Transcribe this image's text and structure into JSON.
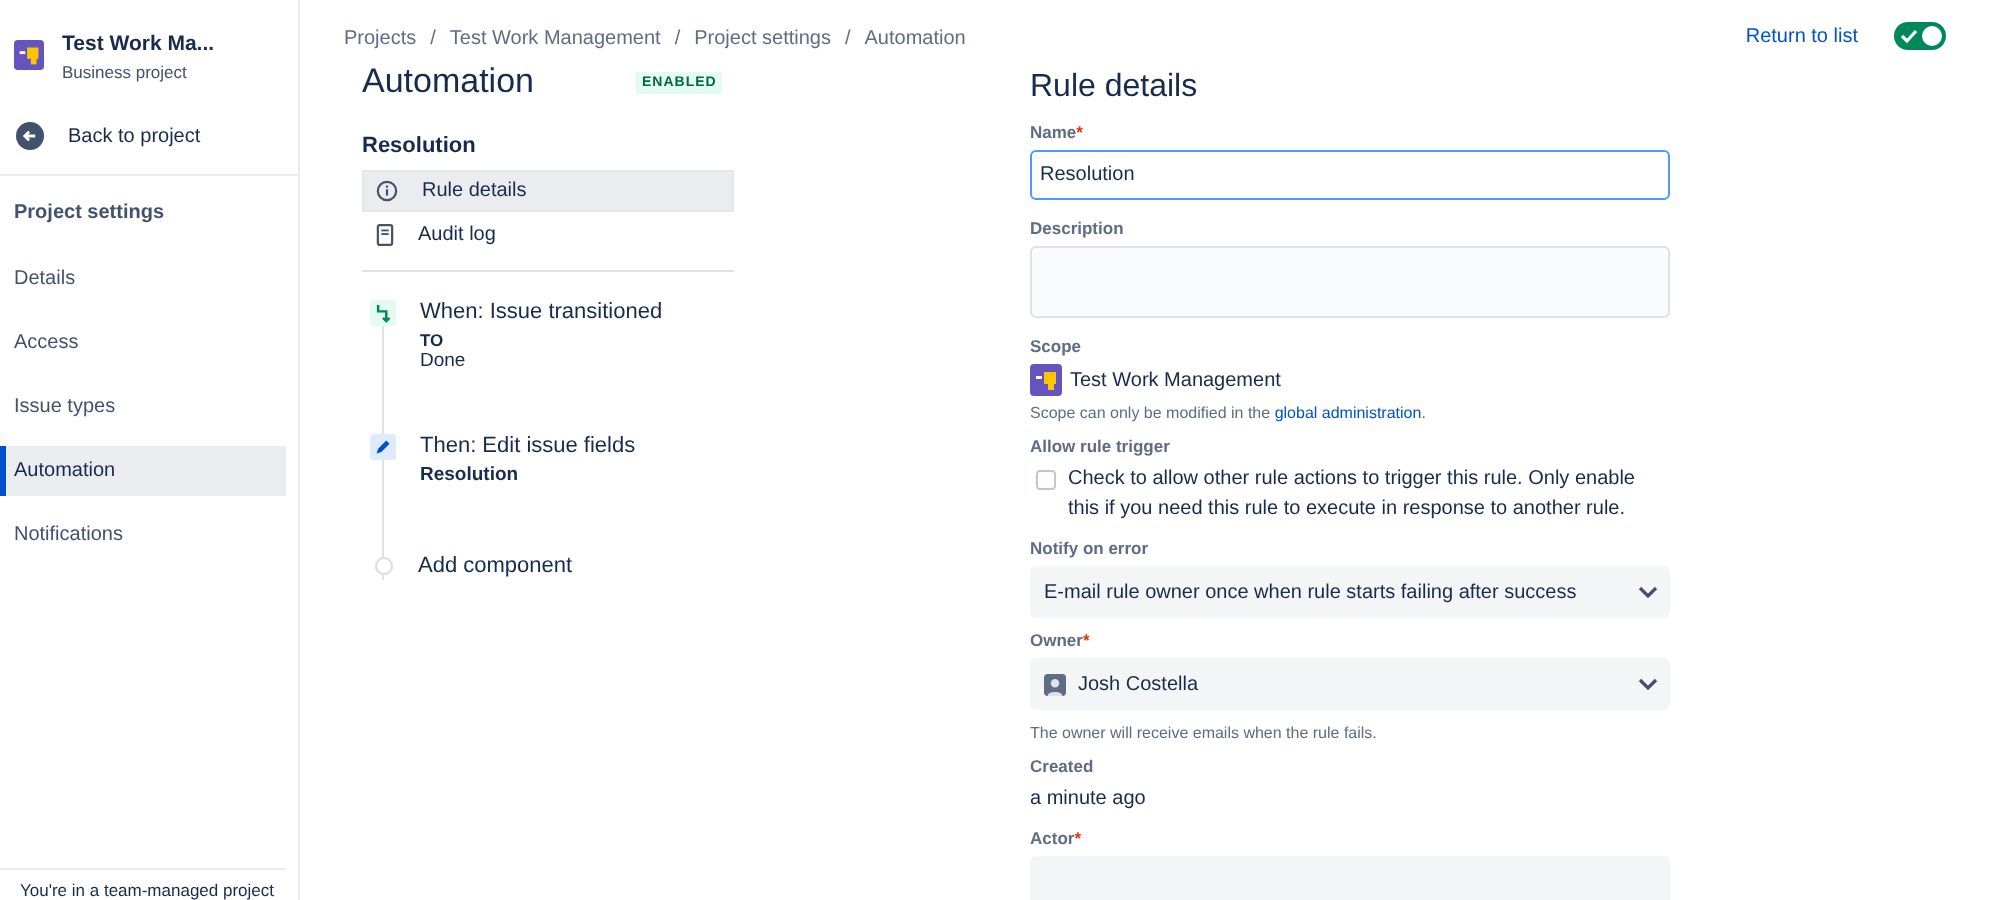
{
  "sidebar": {
    "project": {
      "name": "Test Work Ma...",
      "type": "Business project"
    },
    "back": "Back to project",
    "heading": "Project settings",
    "items": [
      {
        "label": "Details",
        "selected": false
      },
      {
        "label": "Access",
        "selected": false
      },
      {
        "label": "Issue types",
        "selected": false
      },
      {
        "label": "Automation",
        "selected": true
      },
      {
        "label": "Notifications",
        "selected": false
      }
    ],
    "footer": "You're in a team-managed project"
  },
  "breadcrumbs": [
    {
      "label": "Projects"
    },
    {
      "separator": "/",
      "label": "Test Work Management"
    },
    {
      "separator": "/",
      "label": "Project settings"
    },
    {
      "separator": "/",
      "label": "Automation"
    }
  ],
  "header": {
    "title": "Automation",
    "status": "ENABLED",
    "return_link": "Return to list",
    "toggle_on": true
  },
  "rule": {
    "name": "Resolution",
    "nav": [
      {
        "kind": "info",
        "label": "Rule details",
        "selected": true
      },
      {
        "kind": "log",
        "label": "Audit log",
        "selected": false
      }
    ],
    "components": [
      {
        "kind": "trigger",
        "title": "When: Issue transitioned",
        "detail_label": "TO",
        "detail": "Done"
      },
      {
        "kind": "action",
        "title": "Then: Edit issue fields",
        "detail_label": "Resolution"
      },
      {
        "kind": "add",
        "title": "Add component"
      }
    ]
  },
  "details": {
    "title": "Rule details",
    "name_label": "Name",
    "name_required": "*",
    "name_value": "Resolution",
    "description_label": "Description",
    "scope_label": "Scope",
    "scope_project": "Test Work Management",
    "scope_note": "Scope can only be modified in the",
    "scope_link": "global administration",
    "scope_end": ".",
    "trigger_label": "Allow rule trigger",
    "trigger_text": "Check to allow other rule actions to trigger this rule. Only enable this if you need this rule to execute in response to another rule.",
    "trigger_checked": false,
    "notify_label": "Notify on error",
    "notify_value": "E-mail rule owner once when rule starts failing after success",
    "owner_label": "Owner",
    "owner_required": "*",
    "owner_value": "Josh Costella",
    "owner_note": "The owner will receive emails when the rule fails.",
    "created_label": "Created",
    "created_value": "a minute ago",
    "actor_label": "Actor",
    "actor_required": "*"
  }
}
